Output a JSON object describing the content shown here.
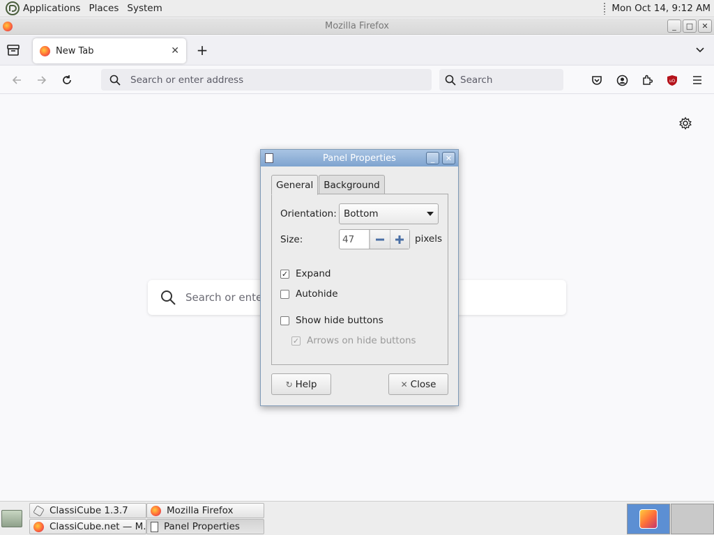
{
  "top_panel": {
    "menus": [
      "Applications",
      "Places",
      "System"
    ],
    "clock": "Mon Oct 14,  9:12 AM"
  },
  "firefox": {
    "window_title": "Mozilla Firefox",
    "tab": {
      "label": "New Tab"
    },
    "url_placeholder": "Search or enter address",
    "search_placeholder": "Search",
    "newtab_search_placeholder": "Search or enter"
  },
  "dialog": {
    "title": "Panel Properties",
    "tabs": [
      "General",
      "Background"
    ],
    "orientation_label": "Orientation:",
    "orientation_value": "Bottom",
    "size_label": "Size:",
    "size_value": "47",
    "size_units": "pixels",
    "expand_label": "Expand",
    "expand_checked": true,
    "autohide_label": "Autohide",
    "autohide_checked": false,
    "show_hide_buttons_label": "Show hide buttons",
    "show_hide_buttons_checked": false,
    "arrows_label": "Arrows on hide buttons",
    "arrows_checked": true,
    "help_label": "Help",
    "close_label": "Close"
  },
  "taskbar": {
    "items": [
      {
        "label": "ClassiCube 1.3.7",
        "icon": "classicube-icon"
      },
      {
        "label": "Mozilla Firefox",
        "icon": "firefox-icon"
      },
      {
        "label": "ClassiCube.net — M...",
        "icon": "firefox-icon"
      },
      {
        "label": "Panel Properties",
        "icon": "panel-icon"
      }
    ]
  },
  "colors": {
    "dialog_title": "#7ea3cf",
    "workspace_active": "#5c8fd3",
    "firefox_orange": "#ff7139"
  }
}
